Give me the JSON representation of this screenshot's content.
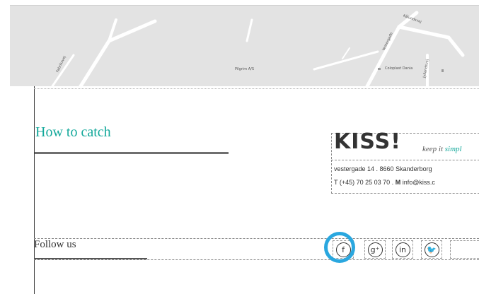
{
  "map": {
    "labels": {
      "center": "Pilgrim A/S",
      "company": "Coloplast Dania",
      "road_left": "Fabriksvej",
      "road_top": "Kålundsvej",
      "road_right1": "Vestergade",
      "road_right2": "Jyllandsvej"
    }
  },
  "main": {
    "title": "How to catch"
  },
  "kiss": {
    "logo": "KISS!",
    "tagline_part1": "keep it ",
    "tagline_part2": "simpl",
    "address_line": "vestergade 14 . 8660 Skanderborg",
    "phone_prefix": "T",
    "phone": "(+45) 70 25 03 70 .",
    "mail_prefix": "M",
    "email": "info@kiss.c"
  },
  "follow": {
    "label": "Follow us",
    "icons": [
      {
        "name": "facebook-icon",
        "glyph": "f"
      },
      {
        "name": "google-plus-icon",
        "glyph": "g⁺"
      },
      {
        "name": "linkedin-icon",
        "glyph": "in"
      },
      {
        "name": "twitter-icon",
        "glyph": "🐦"
      }
    ]
  },
  "colors": {
    "accent_teal": "#12a89a",
    "highlight_blue": "#2aa7df"
  }
}
